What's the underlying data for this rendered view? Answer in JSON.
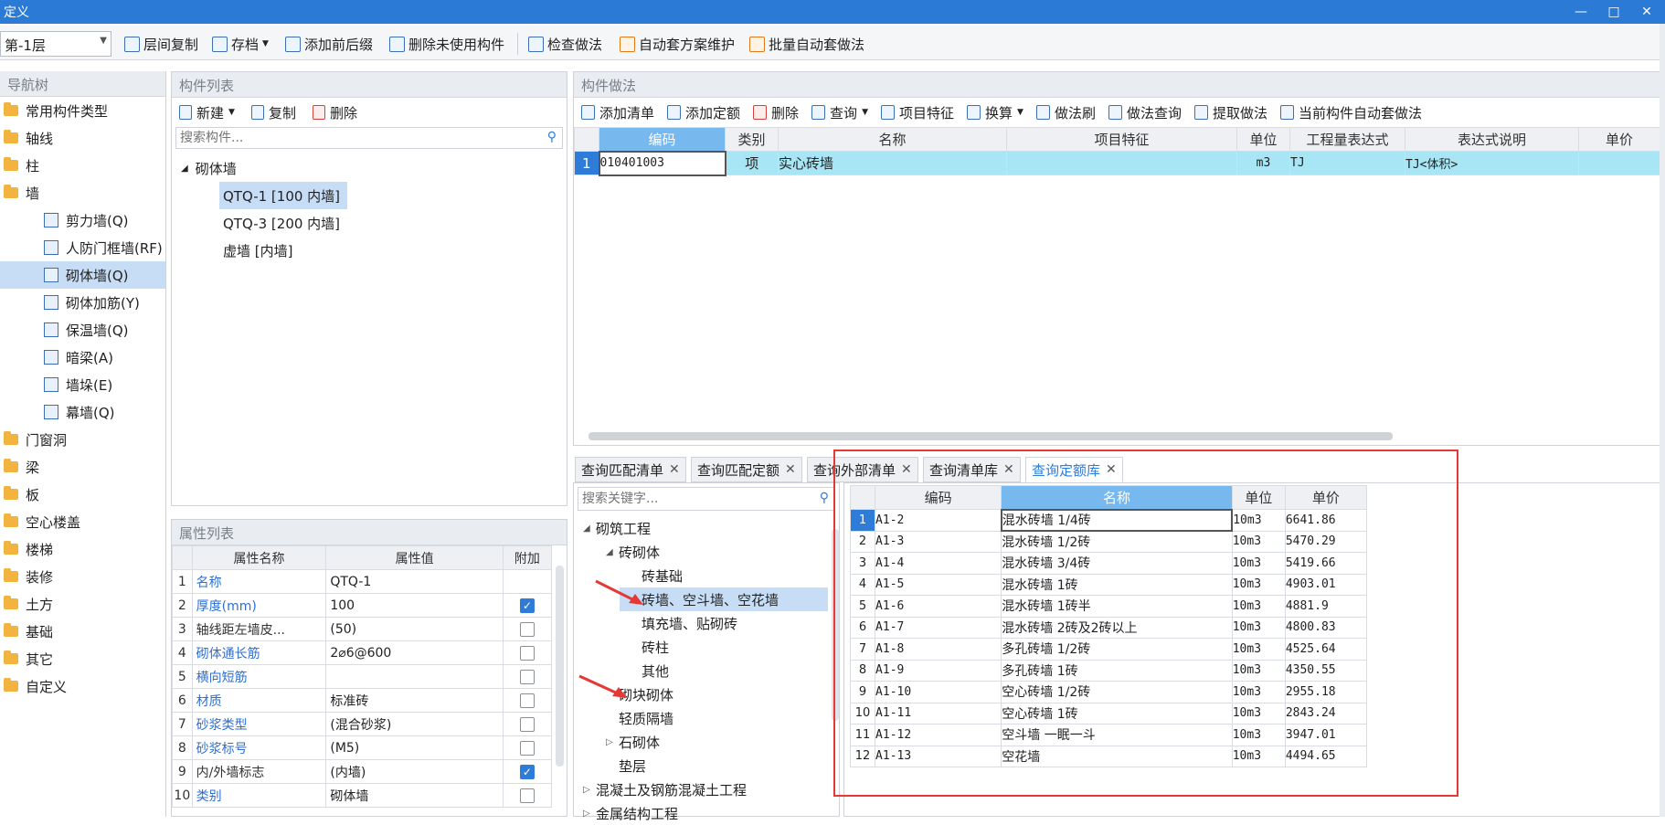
{
  "window": {
    "title": "定义",
    "min": "—",
    "max": "□",
    "close": "✕"
  },
  "toolbar": {
    "floor": "第-1层",
    "buttons": [
      "层间复制",
      "存档",
      "添加前后缀",
      "删除未使用构件",
      "检查做法",
      "自动套方案维护",
      "批量自动套做法"
    ]
  },
  "nav": {
    "header": "导航树",
    "items": [
      {
        "label": "常用构件类型",
        "type": "folder"
      },
      {
        "label": "轴线",
        "type": "folder"
      },
      {
        "label": "柱",
        "type": "folder"
      },
      {
        "label": "墙",
        "type": "folder"
      },
      {
        "label": "剪力墙(Q)",
        "type": "sub"
      },
      {
        "label": "人防门框墙(RF)",
        "type": "sub"
      },
      {
        "label": "砌体墙(Q)",
        "type": "sub",
        "selected": true
      },
      {
        "label": "砌体加筋(Y)",
        "type": "sub"
      },
      {
        "label": "保温墙(Q)",
        "type": "sub"
      },
      {
        "label": "暗梁(A)",
        "type": "sub"
      },
      {
        "label": "墙垛(E)",
        "type": "sub"
      },
      {
        "label": "幕墙(Q)",
        "type": "sub"
      },
      {
        "label": "门窗洞",
        "type": "folder"
      },
      {
        "label": "梁",
        "type": "folder"
      },
      {
        "label": "板",
        "type": "folder"
      },
      {
        "label": "空心楼盖",
        "type": "folder"
      },
      {
        "label": "楼梯",
        "type": "folder"
      },
      {
        "label": "装修",
        "type": "folder"
      },
      {
        "label": "土方",
        "type": "folder"
      },
      {
        "label": "基础",
        "type": "folder"
      },
      {
        "label": "其它",
        "type": "folder"
      },
      {
        "label": "自定义",
        "type": "folder"
      }
    ]
  },
  "components": {
    "header": "构件列表",
    "new": "新建",
    "copy": "复制",
    "delete": "删除",
    "search_placeholder": "搜索构件...",
    "group": "砌体墙",
    "items": [
      "QTQ-1 [100 内墙]",
      "QTQ-3 [200 内墙]",
      "虚墙 [内墙]"
    ]
  },
  "props": {
    "header": "属性列表",
    "cols": [
      "属性名称",
      "属性值",
      "附加"
    ],
    "rows": [
      {
        "n": "1",
        "name": "名称",
        "val": "QTQ-1",
        "cb": null,
        "blue": true
      },
      {
        "n": "2",
        "name": "厚度(mm)",
        "val": "100",
        "cb": true,
        "blue": true
      },
      {
        "n": "3",
        "name": "轴线距左墙皮...",
        "val": "(50)",
        "cb": false,
        "blue": false
      },
      {
        "n": "4",
        "name": "砌体通长筋",
        "val": "2⌀6@600",
        "cb": false,
        "blue": true
      },
      {
        "n": "5",
        "name": "横向短筋",
        "val": "",
        "cb": false,
        "blue": true
      },
      {
        "n": "6",
        "name": "材质",
        "val": "标准砖",
        "cb": false,
        "blue": true
      },
      {
        "n": "7",
        "name": "砂浆类型",
        "val": "(混合砂浆)",
        "cb": false,
        "blue": true
      },
      {
        "n": "8",
        "name": "砂浆标号",
        "val": "(M5)",
        "cb": false,
        "blue": true
      },
      {
        "n": "9",
        "name": "内/外墙标志",
        "val": "(内墙)",
        "cb": true,
        "blue": false
      },
      {
        "n": "10",
        "name": "类别",
        "val": "砌体墙",
        "cb": false,
        "blue": true
      }
    ]
  },
  "method": {
    "header": "构件做法",
    "buttons": [
      "添加清单",
      "添加定额",
      "删除",
      "查询",
      "项目特征",
      "换算",
      "做法刷",
      "做法查询",
      "提取做法",
      "当前构件自动套做法"
    ],
    "cols": [
      "编码",
      "类别",
      "名称",
      "项目特征",
      "单位",
      "工程量表达式",
      "表达式说明",
      "单价"
    ],
    "rows": [
      {
        "n": "1",
        "code": "010401003",
        "cat": "项",
        "name": "实心砖墙",
        "feat": "",
        "unit": "m3",
        "expr": "TJ",
        "desc": "TJ<体积>",
        "price": ""
      }
    ]
  },
  "tabs": [
    "查询匹配清单",
    "查询匹配定额",
    "查询外部清单",
    "查询清单库",
    "查询定额库"
  ],
  "tree": {
    "search_placeholder": "搜索关键字...",
    "items": [
      {
        "label": "砌筑工程",
        "level": 0,
        "arrow": "◢"
      },
      {
        "label": "砖砌体",
        "level": 1,
        "arrow": "◢"
      },
      {
        "label": "砖基础",
        "level": 2,
        "arrow": ""
      },
      {
        "label": "砖墙、空斗墙、空花墙",
        "level": 2,
        "arrow": "",
        "selected": true
      },
      {
        "label": "填充墙、贴砌砖",
        "level": 2,
        "arrow": ""
      },
      {
        "label": "砖柱",
        "level": 2,
        "arrow": ""
      },
      {
        "label": "其他",
        "level": 2,
        "arrow": ""
      },
      {
        "label": "砌块砌体",
        "level": 1,
        "arrow": ""
      },
      {
        "label": "轻质隔墙",
        "level": 1,
        "arrow": ""
      },
      {
        "label": "石砌体",
        "level": 1,
        "arrow": "▷"
      },
      {
        "label": "垫层",
        "level": 1,
        "arrow": ""
      },
      {
        "label": "混凝土及钢筋混凝土工程",
        "level": 0,
        "arrow": "▷"
      },
      {
        "label": "金属结构工程",
        "level": 0,
        "arrow": "▷"
      }
    ]
  },
  "quota": {
    "cols": [
      "编码",
      "名称",
      "单位",
      "单价"
    ],
    "rows": [
      {
        "n": "1",
        "code": "A1-2",
        "name": "混水砖墙 1/4砖",
        "unit": "10m3",
        "price": "6641.86"
      },
      {
        "n": "2",
        "code": "A1-3",
        "name": "混水砖墙 1/2砖",
        "unit": "10m3",
        "price": "5470.29"
      },
      {
        "n": "3",
        "code": "A1-4",
        "name": "混水砖墙 3/4砖",
        "unit": "10m3",
        "price": "5419.66"
      },
      {
        "n": "4",
        "code": "A1-5",
        "name": "混水砖墙 1砖",
        "unit": "10m3",
        "price": "4903.01"
      },
      {
        "n": "5",
        "code": "A1-6",
        "name": "混水砖墙 1砖半",
        "unit": "10m3",
        "price": "4881.9"
      },
      {
        "n": "6",
        "code": "A1-7",
        "name": "混水砖墙 2砖及2砖以上",
        "unit": "10m3",
        "price": "4800.83"
      },
      {
        "n": "7",
        "code": "A1-8",
        "name": "多孔砖墙 1/2砖",
        "unit": "10m3",
        "price": "4525.64"
      },
      {
        "n": "8",
        "code": "A1-9",
        "name": "多孔砖墙 1砖",
        "unit": "10m3",
        "price": "4350.55"
      },
      {
        "n": "9",
        "code": "A1-10",
        "name": "空心砖墙 1/2砖",
        "unit": "10m3",
        "price": "2955.18"
      },
      {
        "n": "10",
        "code": "A1-11",
        "name": "空心砖墙 1砖",
        "unit": "10m3",
        "price": "2843.24"
      },
      {
        "n": "11",
        "code": "A1-12",
        "name": "空斗墙 一眠一斗",
        "unit": "10m3",
        "price": "3947.01"
      },
      {
        "n": "12",
        "code": "A1-13",
        "name": "空花墙",
        "unit": "10m3",
        "price": "4494.65"
      }
    ]
  },
  "colors": {
    "titlebar": "#2b7bd6",
    "selection": "#a8dcf5",
    "highlight": "#e53935"
  }
}
